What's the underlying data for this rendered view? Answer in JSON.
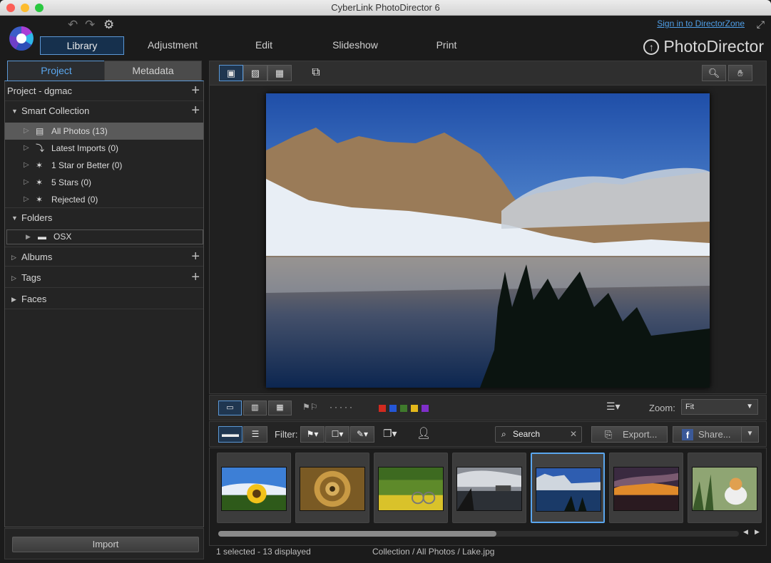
{
  "window": {
    "title": "CyberLink PhotoDirector 6"
  },
  "header": {
    "signin": "Sign in to DirectorZone",
    "brand": "PhotoDirector",
    "brand_icon": "upload-circle-icon"
  },
  "main_tabs": [
    {
      "label": "Library",
      "active": true
    },
    {
      "label": "Adjustment"
    },
    {
      "label": "Edit"
    },
    {
      "label": "Slideshow"
    },
    {
      "label": "Print"
    }
  ],
  "left": {
    "tabs": [
      {
        "label": "Project",
        "active": true
      },
      {
        "label": "Metadata"
      }
    ],
    "project": "Project - dgmac",
    "smart_collection": "Smart Collection",
    "smart_items": [
      {
        "label": "All Photos (13)",
        "selected": true
      },
      {
        "label": "Latest Imports (0)"
      },
      {
        "label": "1 Star or Better (0)"
      },
      {
        "label": "5 Stars (0)"
      },
      {
        "label": "Rejected (0)"
      }
    ],
    "folders": "Folders",
    "folder_items": [
      {
        "label": "OSX"
      }
    ],
    "albums": "Albums",
    "tags": "Tags",
    "faces": "Faces",
    "import": "Import"
  },
  "toolbar": {
    "zoom_label": "Zoom:",
    "zoom_value": "Fit",
    "color_labels": [
      "#d12a1f",
      "#2456d6",
      "#3f7a2c",
      "#e3b81b",
      "#7f2fc9"
    ]
  },
  "filter": {
    "label": "Filter:",
    "search": "Search",
    "export": "Export...",
    "share": "Share..."
  },
  "thumbs": [
    {
      "name": "sunflower",
      "selected": false
    },
    {
      "name": "spiral-staircase",
      "selected": false
    },
    {
      "name": "bicycle-flowers",
      "selected": false
    },
    {
      "name": "pier-clouds",
      "selected": false
    },
    {
      "name": "lake",
      "selected": true
    },
    {
      "name": "sunset",
      "selected": false
    },
    {
      "name": "cat",
      "selected": false
    }
  ],
  "status": {
    "left": "1 selected - 13 displayed",
    "path": "Collection / All Photos / Lake.jpg"
  }
}
